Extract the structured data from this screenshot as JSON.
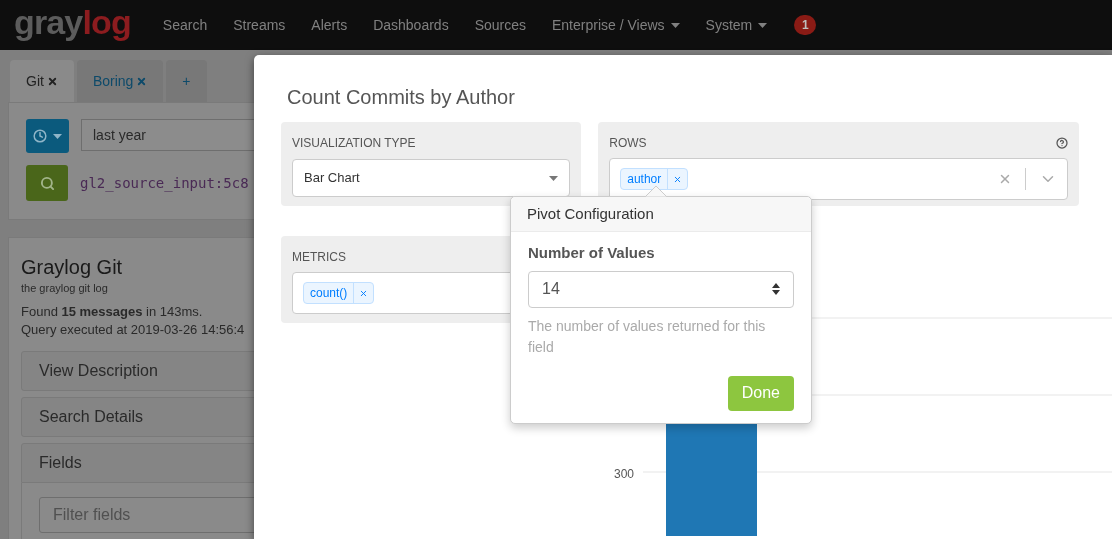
{
  "navbar": {
    "logo": {
      "main": "gray",
      "accent": "log"
    },
    "items": [
      {
        "label": "Search",
        "dropdown": false
      },
      {
        "label": "Streams",
        "dropdown": false
      },
      {
        "label": "Alerts",
        "dropdown": false
      },
      {
        "label": "Dashboards",
        "dropdown": false
      },
      {
        "label": "Sources",
        "dropdown": false
      },
      {
        "label": "Enterprise / Views",
        "dropdown": true
      },
      {
        "label": "System",
        "dropdown": true
      }
    ],
    "notification_count": "1"
  },
  "query_tabs": [
    {
      "kind": "query",
      "label": "Git",
      "selected": true
    },
    {
      "kind": "query",
      "label": "Boring",
      "selected": false
    },
    {
      "kind": "add",
      "label": "+",
      "selected": false
    }
  ],
  "search_bar": {
    "time_range": "last year",
    "query": "gl2_source_input:5c8"
  },
  "view": {
    "title": "Graylog Git",
    "description": "the graylog git log",
    "found": "Found **15 messages** in 143ms.",
    "executed": "Query executed at 2019-03-26 14:56:4",
    "sections": [
      "View Description",
      "Search Details",
      "Fields"
    ],
    "filter_placeholder": "Filter fields"
  },
  "modal": {
    "title": "Count Commits by Author",
    "visualization_type": {
      "label": "VISUALIZATION TYPE",
      "value": "Bar Chart"
    },
    "rows": {
      "label": "ROWS",
      "tags": [
        "author"
      ]
    },
    "metrics": {
      "label": "METRICS",
      "tags": [
        "count()"
      ]
    },
    "chart": {
      "y_tick_label": "300"
    }
  },
  "popover": {
    "title": "Pivot Configuration",
    "field_label": "Number of Values",
    "value": "14",
    "help": "The number of values returned for this field",
    "button": "Done"
  }
}
